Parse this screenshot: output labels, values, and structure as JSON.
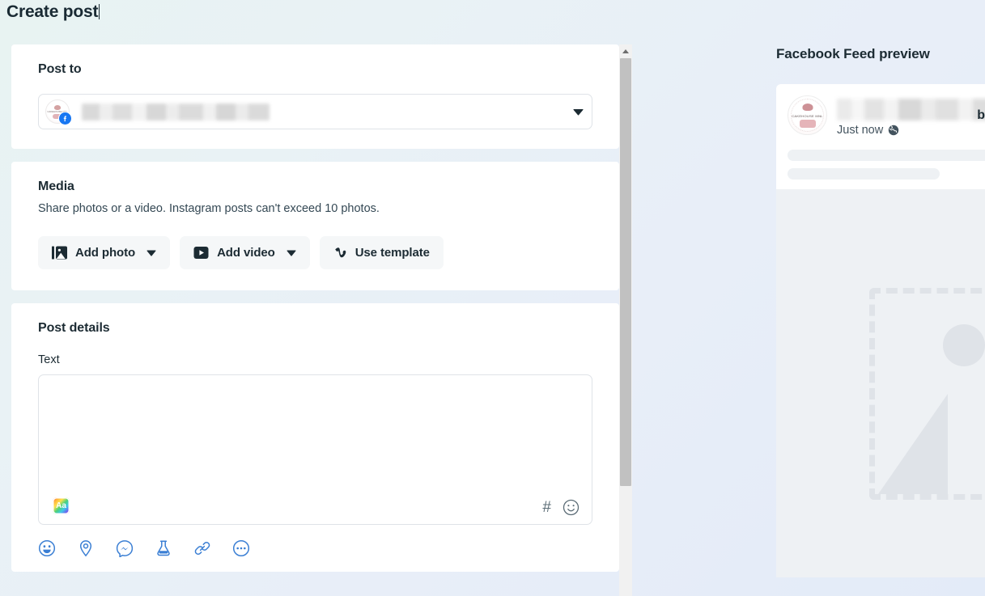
{
  "page": {
    "title": "Create post",
    "caret_visible": true
  },
  "post_to": {
    "heading": "Post to",
    "selected_account_name": "",
    "account_name_redacted": true,
    "badge_network": "facebook",
    "caret_icon": "chevron-down-icon"
  },
  "media": {
    "heading": "Media",
    "description": "Share photos or a video. Instagram posts can't exceed 10 photos.",
    "buttons": [
      {
        "label": "Add photo",
        "icon": "photo-icon",
        "has_caret": true
      },
      {
        "label": "Add video",
        "icon": "video-icon",
        "has_caret": true
      },
      {
        "label": "Use template",
        "icon": "vimeo-v-icon",
        "has_caret": false
      }
    ]
  },
  "post_details": {
    "heading": "Post details",
    "text_field": {
      "label": "Text",
      "value": "",
      "placeholder": ""
    },
    "editor_tools": {
      "font_style_icon": "aa-text-style-icon",
      "font_style_label": "Aa",
      "hashtag_icon": "hashtag-icon",
      "hashtag_label": "#",
      "emoji_icon": "emoji-smiley-icon"
    },
    "action_icons": [
      {
        "name": "feeling-activity-icon"
      },
      {
        "name": "location-pin-icon"
      },
      {
        "name": "messenger-icon"
      },
      {
        "name": "flask-experiment-icon"
      },
      {
        "name": "link-icon"
      },
      {
        "name": "more-options-icon"
      }
    ]
  },
  "scrollbar": {
    "up_arrow_icon": "scroll-up-arrow-icon",
    "thumb_label": "vertical-scroll-thumb"
  },
  "preview": {
    "title": "Facebook Feed preview",
    "post": {
      "author_name": "",
      "author_name_redacted": true,
      "overflow_char": "b",
      "timestamp": "Just now",
      "privacy_icon": "globe-public-icon",
      "body_placeholder_lines": 2,
      "media_placeholder_icon": "image-placeholder-icon"
    }
  },
  "colors": {
    "facebook_blue": "#1877f2",
    "icon_blue": "#3b7fd4",
    "background_start": "#e8f3f2",
    "background_end": "#e3ebf8",
    "card_white": "#ffffff",
    "border_grey": "#dfe3e8",
    "placeholder_grey": "#eef1f4",
    "scrollbar_thumb": "#c1c1c1"
  }
}
